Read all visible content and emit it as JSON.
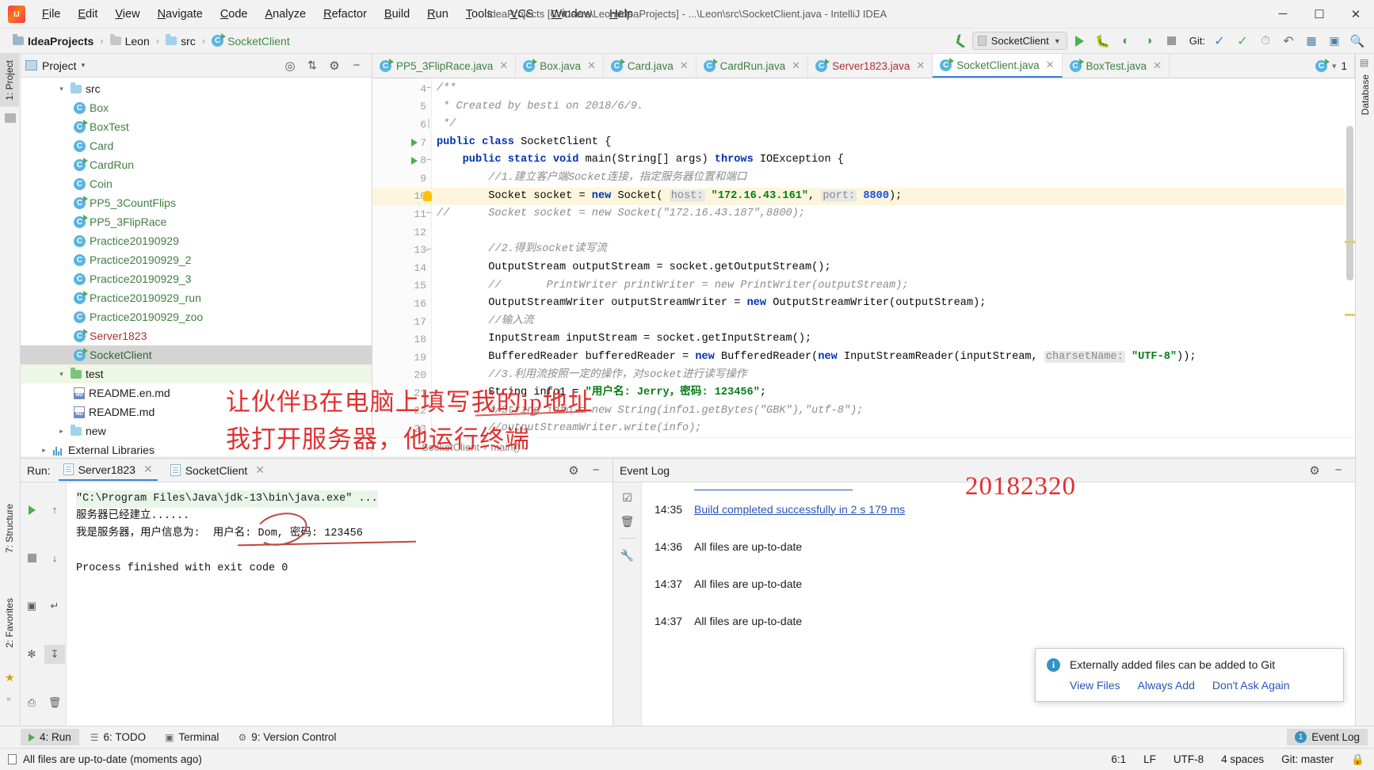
{
  "window": {
    "title": "IdeaProjects [C:\\Users\\Leon\\IdeaProjects] - ...\\Leon\\src\\SocketClient.java - IntelliJ IDEA",
    "minimize": "─",
    "maximize": "☐",
    "close": "✕"
  },
  "menubar": {
    "items": [
      {
        "label": "File"
      },
      {
        "label": "Edit"
      },
      {
        "label": "View"
      },
      {
        "label": "Navigate"
      },
      {
        "label": "Code"
      },
      {
        "label": "Analyze"
      },
      {
        "label": "Refactor"
      },
      {
        "label": "Build"
      },
      {
        "label": "Run"
      },
      {
        "label": "Tools"
      },
      {
        "label": "VCS"
      },
      {
        "label": "Window"
      },
      {
        "label": "Help"
      }
    ]
  },
  "navbar": {
    "breadcrumbs": [
      {
        "label": "IdeaProjects",
        "icon": "project-folder-icon"
      },
      {
        "label": "Leon",
        "icon": "folder-icon"
      },
      {
        "label": "src",
        "icon": "folder-icon"
      },
      {
        "label": "SocketClient",
        "icon": "java-class-icon"
      }
    ],
    "separator": "›",
    "run_config": "SocketClient",
    "git_label": "Git:",
    "back_icon": "back-arrow-icon",
    "run_icon": "run-icon",
    "debug_icon": "debug-icon",
    "coverage_icon": "run-with-coverage-icon",
    "profile_icon": "profiler-icon",
    "stop_icon": "stop-icon",
    "update_icon": "git-update-icon",
    "commit_icon": "git-commit-icon",
    "history_icon": "git-history-icon",
    "revert_icon": "git-revert-icon",
    "settings_icon": "settings-icon",
    "layout_icon": "layout-icon",
    "search_icon": "search-everywhere-icon"
  },
  "rails": {
    "left": [
      {
        "label": "1: Project",
        "active": true
      },
      {
        "label": "7: Structure",
        "active": false
      },
      {
        "label": "2: Favorites",
        "active": false
      }
    ],
    "right": [
      {
        "label": "Database",
        "active": false
      }
    ]
  },
  "project_panel": {
    "title": "Project",
    "dropdown_caret": "▾",
    "locate_icon": "locate-icon",
    "collapse_icon": "collapse-all-icon",
    "settings_icon": "gear-icon",
    "hide_icon": "hide-icon",
    "tree": [
      {
        "label": "src",
        "type": "folder",
        "indent": 1,
        "expanded": true,
        "color": "plain"
      },
      {
        "label": "Box",
        "type": "class",
        "indent": 2,
        "color": "green"
      },
      {
        "label": "BoxTest",
        "type": "class-run",
        "indent": 2,
        "color": "green"
      },
      {
        "label": "Card",
        "type": "class",
        "indent": 2,
        "color": "green"
      },
      {
        "label": "CardRun",
        "type": "class-run",
        "indent": 2,
        "color": "green"
      },
      {
        "label": "Coin",
        "type": "class",
        "indent": 2,
        "color": "green"
      },
      {
        "label": "PP5_3CountFlips",
        "type": "class-run",
        "indent": 2,
        "color": "green"
      },
      {
        "label": "PP5_3FlipRace",
        "type": "class-run",
        "indent": 2,
        "color": "green"
      },
      {
        "label": "Practice20190929",
        "type": "class",
        "indent": 2,
        "color": "green"
      },
      {
        "label": "Practice20190929_2",
        "type": "class",
        "indent": 2,
        "color": "green"
      },
      {
        "label": "Practice20190929_3",
        "type": "class",
        "indent": 2,
        "color": "green"
      },
      {
        "label": "Practice20190929_run",
        "type": "class-run",
        "indent": 2,
        "color": "green"
      },
      {
        "label": "Practice20190929_zoo",
        "type": "class",
        "indent": 2,
        "color": "green"
      },
      {
        "label": "Server1823",
        "type": "class-run",
        "indent": 2,
        "color": "red"
      },
      {
        "label": "SocketClient",
        "type": "class-run",
        "indent": 2,
        "color": "dgreen",
        "selected": true
      },
      {
        "label": "test",
        "type": "folder-test",
        "indent": 1,
        "expanded": true,
        "color": "plain"
      },
      {
        "label": "README.en.md",
        "type": "md",
        "indent": 2,
        "color": "plain"
      },
      {
        "label": "README.md",
        "type": "md",
        "indent": 2,
        "color": "plain"
      },
      {
        "label": "new",
        "type": "folder",
        "indent": 1,
        "expanded": false,
        "color": "plain"
      },
      {
        "label": "External Libraries",
        "type": "lib",
        "indent": 0,
        "expanded": false,
        "color": "plain"
      }
    ]
  },
  "editor": {
    "tabs": [
      {
        "label": "PP5_3FlipRace.java",
        "icon": "java-class-run-icon",
        "color": "green",
        "active": false
      },
      {
        "label": "Box.java",
        "icon": "java-class-icon",
        "color": "green",
        "active": false
      },
      {
        "label": "Card.java",
        "icon": "java-class-icon",
        "color": "green",
        "active": false
      },
      {
        "label": "CardRun.java",
        "icon": "java-class-run-icon",
        "color": "green",
        "active": false
      },
      {
        "label": "Server1823.java",
        "icon": "java-class-run-icon",
        "color": "red",
        "active": false
      },
      {
        "label": "SocketClient.java",
        "icon": "java-class-run-icon",
        "color": "dgreen",
        "active": true
      },
      {
        "label": "BoxTest.java",
        "icon": "java-class-run-icon",
        "color": "green",
        "active": false
      }
    ],
    "tab_close": "✕",
    "tab_overflow_count": "1",
    "breadcrumb": [
      "SocketClient",
      "main()"
    ],
    "breadcrumb_sep": "›",
    "lines": [
      {
        "n": 4,
        "marker": "fold-start",
        "tokens": [
          {
            "t": "/**",
            "c": "cmt"
          }
        ],
        "indent": 1
      },
      {
        "n": 5,
        "marker": "",
        "tokens": [
          {
            "t": " * Created by besti on 2018/6/9.",
            "c": "cmt"
          }
        ],
        "indent": 1
      },
      {
        "n": 6,
        "marker": "fold-end",
        "tokens": [
          {
            "t": " */",
            "c": "cmt"
          }
        ],
        "indent": 1
      },
      {
        "n": 7,
        "marker": "run",
        "tokens": [
          {
            "t": "public class ",
            "c": "kw"
          },
          {
            "t": "SocketClient {",
            "c": "txt"
          }
        ],
        "indent": 0
      },
      {
        "n": 8,
        "marker": "run-fold",
        "tokens": [
          {
            "t": "    public static void ",
            "c": "kw"
          },
          {
            "t": "main(String[] args) ",
            "c": "txt"
          },
          {
            "t": "throws ",
            "c": "kw"
          },
          {
            "t": "IOException {",
            "c": "txt"
          }
        ],
        "indent": 0
      },
      {
        "n": 9,
        "marker": "",
        "tokens": [
          {
            "t": "        //1.建立客户端Socket连接，指定服务器位置和端口",
            "c": "cmt"
          }
        ],
        "indent": 0
      },
      {
        "n": 10,
        "marker": "bulb",
        "highlight": true,
        "tokens": [
          {
            "t": "        Socket socket = ",
            "c": "txt"
          },
          {
            "t": "new ",
            "c": "kw"
          },
          {
            "t": "Socket( ",
            "c": "txt"
          },
          {
            "t": "host:",
            "c": "hint"
          },
          {
            "t": " ",
            "c": "txt"
          },
          {
            "t": "\"172.16.43.161\"",
            "c": "str"
          },
          {
            "t": ", ",
            "c": "txt"
          },
          {
            "t": "port:",
            "c": "hint"
          },
          {
            "t": " ",
            "c": "txt"
          },
          {
            "t": "8800",
            "c": "num"
          },
          {
            "t": ");",
            "c": "txt"
          }
        ],
        "indent": 0
      },
      {
        "n": 11,
        "marker": "fold-start",
        "tokens": [
          {
            "t": "//      Socket socket = new Socket(\"172.16.43.187\",8800);",
            "c": "cmt"
          }
        ],
        "indent": 0
      },
      {
        "n": 12,
        "marker": "",
        "tokens": [
          {
            "t": "",
            "c": "txt"
          }
        ],
        "indent": 0
      },
      {
        "n": 13,
        "marker": "fold-mid",
        "tokens": [
          {
            "t": "        //2.得到socket读写流",
            "c": "cmt"
          }
        ],
        "indent": 0
      },
      {
        "n": 14,
        "marker": "",
        "tokens": [
          {
            "t": "        OutputStream outputStream = socket.getOutputStream();",
            "c": "txt"
          }
        ],
        "indent": 0
      },
      {
        "n": 15,
        "marker": "",
        "tokens": [
          {
            "t": "        //       PrintWriter printWriter = new PrintWriter(outputStream);",
            "c": "cmt"
          }
        ],
        "indent": 0
      },
      {
        "n": 16,
        "marker": "",
        "tokens": [
          {
            "t": "        OutputStreamWriter outputStreamWriter = ",
            "c": "txt"
          },
          {
            "t": "new ",
            "c": "kw"
          },
          {
            "t": "OutputStreamWriter(outputStream);",
            "c": "txt"
          }
        ],
        "indent": 0
      },
      {
        "n": 17,
        "marker": "",
        "tokens": [
          {
            "t": "        //输入流",
            "c": "cmt"
          }
        ],
        "indent": 0
      },
      {
        "n": 18,
        "marker": "",
        "tokens": [
          {
            "t": "        InputStream inputStream = socket.getInputStream();",
            "c": "txt"
          }
        ],
        "indent": 0
      },
      {
        "n": 19,
        "marker": "",
        "tokens": [
          {
            "t": "        BufferedReader bufferedReader = ",
            "c": "txt"
          },
          {
            "t": "new ",
            "c": "kw"
          },
          {
            "t": "BufferedReader(",
            "c": "txt"
          },
          {
            "t": "new ",
            "c": "kw"
          },
          {
            "t": "InputStreamReader(inputStream, ",
            "c": "txt"
          },
          {
            "t": "charsetName:",
            "c": "hint"
          },
          {
            "t": " ",
            "c": "txt"
          },
          {
            "t": "\"UTF-8\"",
            "c": "str"
          },
          {
            "t": "));",
            "c": "txt"
          }
        ],
        "indent": 0
      },
      {
        "n": 20,
        "marker": "",
        "tokens": [
          {
            "t": "        //3.利用流按照一定的操作，对socket进行读写操作",
            "c": "cmt"
          }
        ],
        "indent": 0
      },
      {
        "n": 21,
        "marker": "",
        "tokens": [
          {
            "t": "        String info1 = ",
            "c": "txt"
          },
          {
            "t": "\"用户名: Jerry，密码: 123456\"",
            "c": "str"
          },
          {
            "t": ";",
            "c": "txt"
          }
        ],
        "indent": 0
      },
      {
        "n": 22,
        "marker": "",
        "tokens": [
          {
            "t": "        //String info = new String(info1.getBytes(\"GBK\"),\"utf-8\");",
            "c": "cmt"
          }
        ],
        "indent": 0
      },
      {
        "n": 23,
        "marker": "",
        "tokens": [
          {
            "t": "        //outputStreamWriter.write(info);",
            "c": "cmt"
          }
        ],
        "indent": 0
      }
    ]
  },
  "run_panel": {
    "label": "Run:",
    "tabs": [
      {
        "label": "Server1823",
        "active": true
      },
      {
        "label": "SocketClient",
        "active": false
      }
    ],
    "tab_close": "✕",
    "gutter_icons": [
      {
        "name": "rerun-icon",
        "glyph": "▶"
      },
      {
        "name": "up-arrow-icon",
        "glyph": "↑"
      },
      {
        "name": "stop-icon",
        "glyph": "■"
      },
      {
        "name": "down-arrow-icon",
        "glyph": "↓"
      },
      {
        "name": "camera-icon",
        "glyph": "▣"
      },
      {
        "name": "soft-wrap-icon",
        "glyph": "↵"
      },
      {
        "name": "pin-icon",
        "glyph": "✥"
      },
      {
        "name": "scroll-end-icon",
        "glyph": "↧"
      },
      {
        "name": "print-icon",
        "glyph": "⎙"
      },
      {
        "name": "trash-icon",
        "glyph": "🗑"
      }
    ],
    "console": [
      {
        "text": "\"C:\\Program Files\\Java\\jdk-13\\bin\\java.exe\" ...",
        "style": "cmd"
      },
      {
        "text": "服务器已经建立......",
        "style": "plain"
      },
      {
        "text": "我是服务器，用户信息为:  用户名: Dom, 密码: 123456",
        "style": "plain"
      },
      {
        "text": "",
        "style": "plain"
      },
      {
        "text": "Process finished with exit code 0",
        "style": "plain"
      }
    ]
  },
  "event_log": {
    "title": "Event Log",
    "settings_icon": "gear-icon",
    "hide_icon": "hide-icon",
    "gutter_icons": [
      {
        "name": "mark-read-icon",
        "glyph": "☑"
      },
      {
        "name": "trash-icon",
        "glyph": "🗑"
      },
      {
        "name": "wrench-icon",
        "glyph": "🔧"
      }
    ],
    "entries": [
      {
        "time": "14:35",
        "message": "Build completed successfully in 2 s 179 ms",
        "link": true
      },
      {
        "time": "14:36",
        "message": "All files are up-to-date",
        "link": false
      },
      {
        "time": "14:37",
        "message": "All files are up-to-date",
        "link": false
      },
      {
        "time": "14:37",
        "message": "All files are up-to-date",
        "link": false
      }
    ]
  },
  "notification": {
    "icon": "info-icon",
    "icon_glyph": "i",
    "message": "Externally added files can be added to Git",
    "actions": [
      {
        "label": "View Files"
      },
      {
        "label": "Always Add"
      },
      {
        "label": "Don't Ask Again"
      }
    ]
  },
  "bottom_tabs": {
    "items": [
      {
        "label": "4: Run",
        "icon": "run-icon",
        "glyph": "▶",
        "active": true
      },
      {
        "label": "6: TODO",
        "icon": "todo-icon",
        "glyph": "☰",
        "active": false
      },
      {
        "label": "Terminal",
        "icon": "terminal-icon",
        "glyph": "▣",
        "active": false
      },
      {
        "label": "9: Version Control",
        "icon": "version-control-icon",
        "glyph": "⎇",
        "active": false
      }
    ],
    "event_log_button": {
      "label": "Event Log",
      "badge": "1"
    }
  },
  "statusbar": {
    "message": "All files are up-to-date (moments ago)",
    "caret": "6:1",
    "line_separator": "LF",
    "encoding": "UTF-8",
    "indent": "4 spaces",
    "branch": "Git: master",
    "lock_icon": "lock-icon"
  },
  "annotations": [
    {
      "text": "让伙伴B在电脑上填写我的ip地址",
      "name": "handwritten-note-1"
    },
    {
      "text": "我打开服务器，他运行终端",
      "name": "handwritten-note-2"
    },
    {
      "text": "20182320",
      "name": "handwritten-student-id"
    }
  ]
}
